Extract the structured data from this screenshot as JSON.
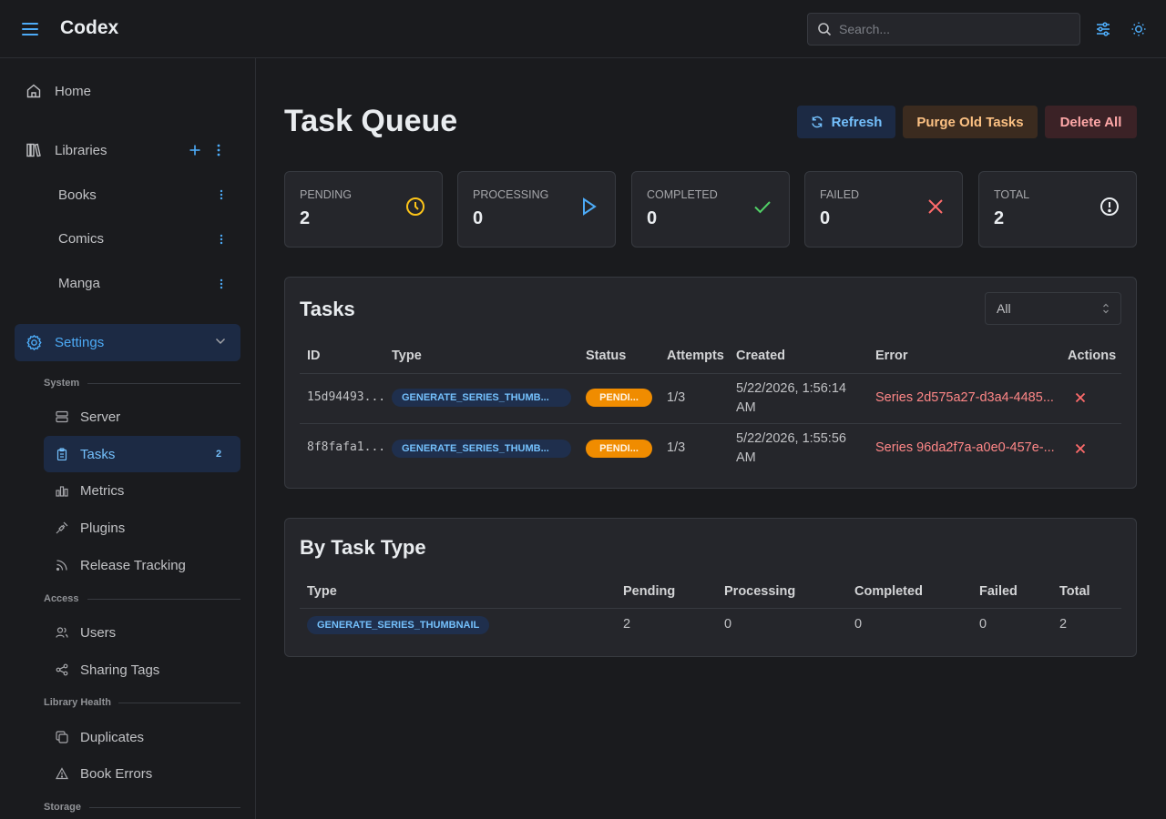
{
  "app": {
    "name": "Codex"
  },
  "search": {
    "placeholder": "Search..."
  },
  "sidebar": {
    "home": "Home",
    "libraries": {
      "label": "Libraries",
      "items": [
        {
          "label": "Books"
        },
        {
          "label": "Comics"
        },
        {
          "label": "Manga"
        }
      ]
    },
    "settings": "Settings",
    "sections": [
      {
        "label": "System",
        "items": [
          {
            "label": "Server",
            "icon": "server-icon"
          },
          {
            "label": "Tasks",
            "icon": "clipboard-icon",
            "badge": "2",
            "active": true
          },
          {
            "label": "Metrics",
            "icon": "bar-chart-icon"
          },
          {
            "label": "Plugins",
            "icon": "plug-icon"
          },
          {
            "label": "Release Tracking",
            "icon": "rss-icon"
          }
        ]
      },
      {
        "label": "Access",
        "items": [
          {
            "label": "Users",
            "icon": "users-icon"
          },
          {
            "label": "Sharing Tags",
            "icon": "share-icon"
          }
        ]
      },
      {
        "label": "Library Health",
        "items": [
          {
            "label": "Duplicates",
            "icon": "copy-icon"
          },
          {
            "label": "Book Errors",
            "icon": "alert-triangle-icon"
          }
        ]
      },
      {
        "label": "Storage",
        "items": []
      }
    ]
  },
  "page": {
    "title": "Task Queue",
    "actions": {
      "refresh": "Refresh",
      "purge": "Purge Old Tasks",
      "delete_all": "Delete All"
    }
  },
  "stats": [
    {
      "label": "PENDING",
      "value": "2",
      "icon": "clock-icon",
      "color": "#fcc419"
    },
    {
      "label": "PROCESSING",
      "value": "0",
      "icon": "play-icon",
      "color": "#4dabf7"
    },
    {
      "label": "COMPLETED",
      "value": "0",
      "icon": "check-icon",
      "color": "#51cf66"
    },
    {
      "label": "FAILED",
      "value": "0",
      "icon": "x-icon",
      "color": "#ff6b6b"
    },
    {
      "label": "TOTAL",
      "value": "2",
      "icon": "alert-circle-icon",
      "color": "#e9ecef"
    }
  ],
  "tasks": {
    "title": "Tasks",
    "filter": "All",
    "columns": [
      "ID",
      "Type",
      "Status",
      "Attempts",
      "Created",
      "Error",
      "Actions"
    ],
    "rows": [
      {
        "id": "15d94493...",
        "type": "GENERATE_SERIES_THUMB...",
        "status": "PENDI...",
        "attempts": "1/3",
        "created_1": "5/22/2026, 1:56:14",
        "created_2": "AM",
        "error": "Series 2d575a27-d3a4-4485..."
      },
      {
        "id": "8f8fafa1...",
        "type": "GENERATE_SERIES_THUMB...",
        "status": "PENDI...",
        "attempts": "1/3",
        "created_1": "5/22/2026, 1:55:56",
        "created_2": "AM",
        "error": "Series 96da2f7a-a0e0-457e-..."
      }
    ]
  },
  "by_type": {
    "title": "By Task Type",
    "columns": [
      "Type",
      "Pending",
      "Processing",
      "Completed",
      "Failed",
      "Total"
    ],
    "rows": [
      {
        "type": "GENERATE_SERIES_THUMBNAIL",
        "pending": "2",
        "processing": "0",
        "completed": "0",
        "failed": "0",
        "total": "2"
      }
    ]
  },
  "colors": {
    "accent": "#4dabf7",
    "background": "#1a1b1e",
    "card": "#25262b",
    "pending": "#f08c00",
    "error": "#ff8787"
  }
}
